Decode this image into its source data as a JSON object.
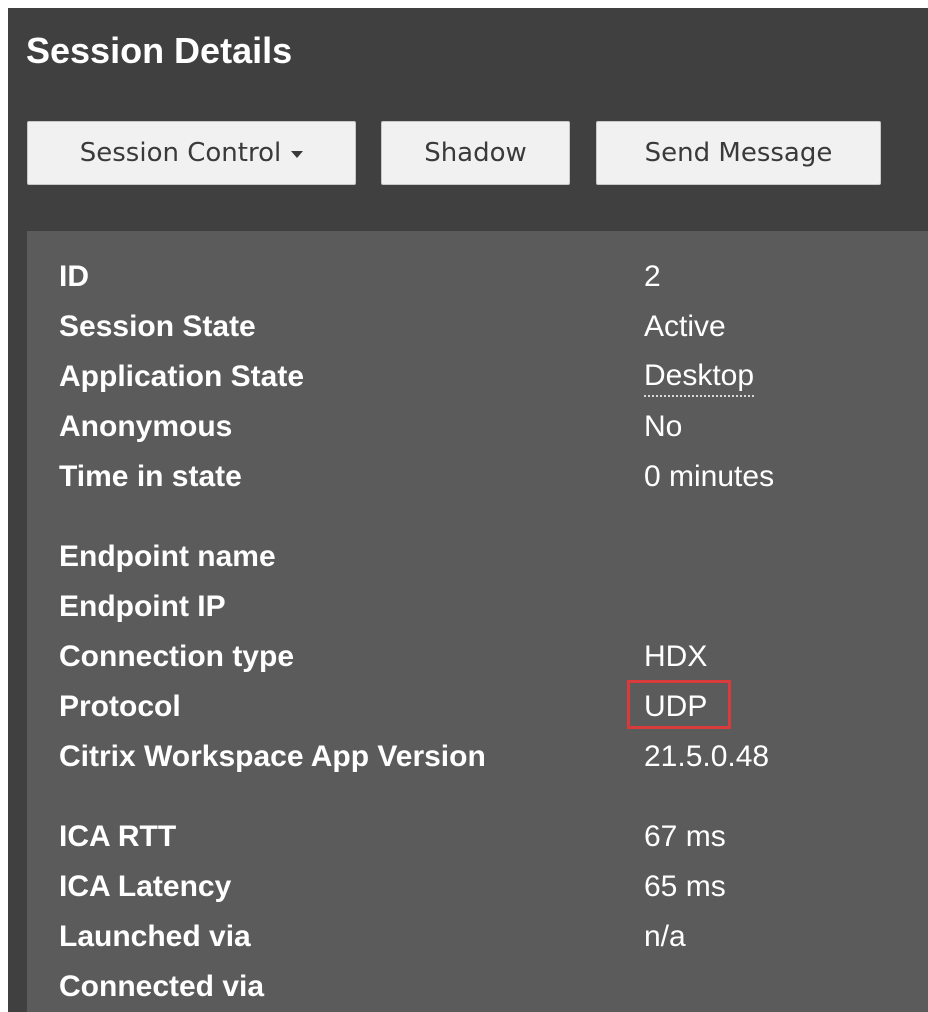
{
  "header": {
    "title": "Session Details"
  },
  "toolbar": {
    "session_control_label": "Session Control",
    "shadow_label": "Shadow",
    "send_message_label": "Send Message"
  },
  "details": {
    "id": {
      "label": "ID",
      "value": "2"
    },
    "session_state": {
      "label": "Session State",
      "value": "Active"
    },
    "application_state": {
      "label": "Application State",
      "value": "Desktop"
    },
    "anonymous": {
      "label": "Anonymous",
      "value": "No"
    },
    "time_in_state": {
      "label": "Time in state",
      "value": "0 minutes"
    },
    "endpoint_name": {
      "label": "Endpoint name",
      "value": ""
    },
    "endpoint_ip": {
      "label": "Endpoint IP",
      "value": ""
    },
    "connection_type": {
      "label": "Connection type",
      "value": "HDX"
    },
    "protocol": {
      "label": "Protocol",
      "value": "UDP"
    },
    "workspace_version": {
      "label": "Citrix Workspace App Version",
      "value": "21.5.0.48"
    },
    "ica_rtt": {
      "label": "ICA RTT",
      "value": "67 ms"
    },
    "ica_latency": {
      "label": "ICA Latency",
      "value": "65 ms"
    },
    "launched_via": {
      "label": "Launched via",
      "value": "n/a"
    },
    "connected_via": {
      "label": "Connected via",
      "value": ""
    }
  },
  "colors": {
    "panel_background": "#404040",
    "details_background": "#5b5b5b",
    "button_background": "#f1f1f1",
    "highlight_border": "#d93a3a",
    "text": "#ffffff"
  },
  "icons": {
    "session_control_caret": "caret-down-icon"
  }
}
